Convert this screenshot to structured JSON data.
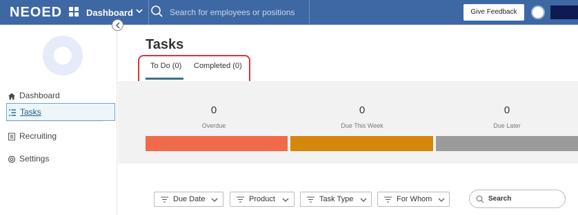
{
  "topbar": {
    "brand": "NEOED",
    "nav_label": "Dashboard",
    "search_placeholder": "Search for employees or positions",
    "feedback_label": "Give Feedback"
  },
  "sidebar": {
    "items": [
      {
        "label": "Dashboard",
        "icon": "home-icon"
      },
      {
        "label": "Tasks",
        "icon": "list-icon",
        "active": true
      },
      {
        "label": "Recruiting",
        "icon": "document-icon"
      },
      {
        "label": "Settings",
        "icon": "gear-icon"
      }
    ]
  },
  "main": {
    "title": "Tasks",
    "tabs": [
      {
        "label": "To Do (0)",
        "active": true
      },
      {
        "label": "Completed (0)"
      }
    ],
    "stats": [
      {
        "value": "0",
        "label": "Overdue",
        "color": "#ef6b4a"
      },
      {
        "value": "0",
        "label": "Due This Week",
        "color": "#d4870a"
      },
      {
        "value": "0",
        "label": "Due Later",
        "color": "#9b9b9b"
      }
    ],
    "filters": [
      {
        "label": "Due Date"
      },
      {
        "label": "Product"
      },
      {
        "label": "Task Type"
      },
      {
        "label": "For Whom"
      }
    ],
    "search_label": "Search"
  },
  "colors": {
    "nav_bg": "#3e68a4",
    "highlight": "#e0303a",
    "active_tab": "#3a6f8f"
  }
}
